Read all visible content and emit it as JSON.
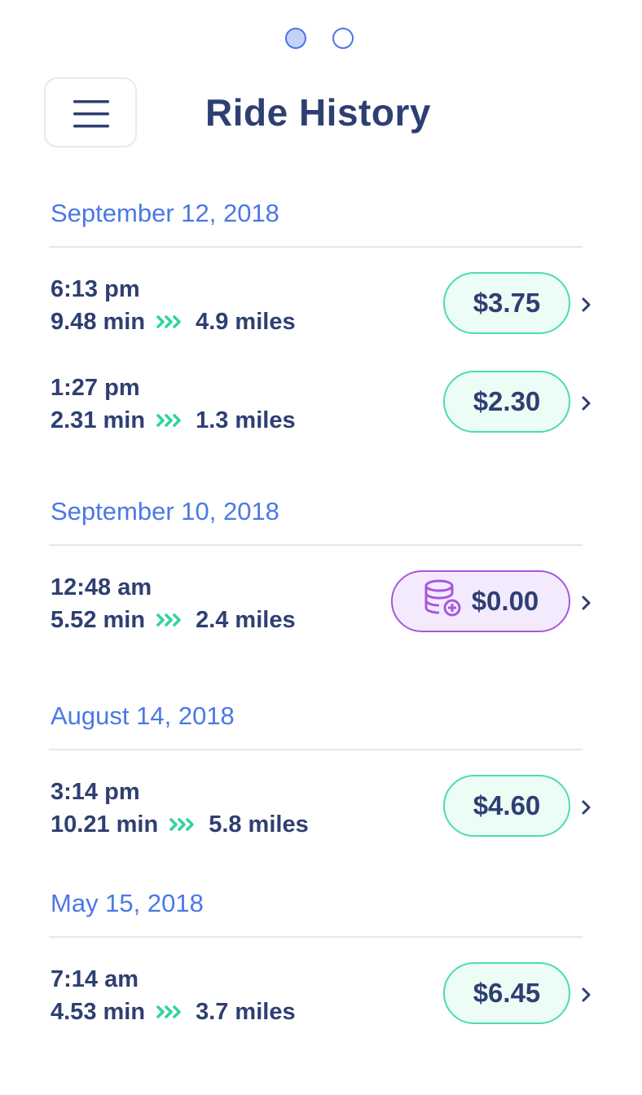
{
  "title": "Ride History",
  "pager": {
    "count": 2,
    "active_index": 0
  },
  "colors": {
    "accent_blue": "#4c78e6",
    "text_navy": "#2e3f72",
    "pill_green_border": "#4ddbb0",
    "pill_green_bg": "#ecfdf6",
    "pill_purple_border": "#a756e0",
    "pill_purple_bg": "#f3ebfd",
    "chevron_green": "#2ed3a0"
  },
  "icons": {
    "menu": "hamburger-menu-icon",
    "distance": "triple-chevron-right-icon",
    "credit": "coin-stack-plus-icon",
    "detail": "chevron-right-icon"
  },
  "groups": [
    {
      "date": "September 12, 2018",
      "rides": [
        {
          "time": "6:13 pm",
          "duration": "9.48 min",
          "distance": "4.9 miles",
          "price": "$3.75",
          "credit": false
        },
        {
          "time": "1:27 pm",
          "duration": "2.31 min",
          "distance": "1.3 miles",
          "price": "$2.30",
          "credit": false
        }
      ]
    },
    {
      "date": "September 10, 2018",
      "rides": [
        {
          "time": "12:48 am",
          "duration": "5.52 min",
          "distance": "2.4 miles",
          "price": "$0.00",
          "credit": true
        }
      ]
    },
    {
      "date": "August 14, 2018",
      "rides": [
        {
          "time": "3:14 pm",
          "duration": "10.21 min",
          "distance": "5.8 miles",
          "price": "$4.60",
          "credit": false
        }
      ]
    },
    {
      "date": "May 15, 2018",
      "rides": [
        {
          "time": "7:14 am",
          "duration": "4.53 min",
          "distance": "3.7 miles",
          "price": "$6.45",
          "credit": false
        }
      ]
    }
  ]
}
